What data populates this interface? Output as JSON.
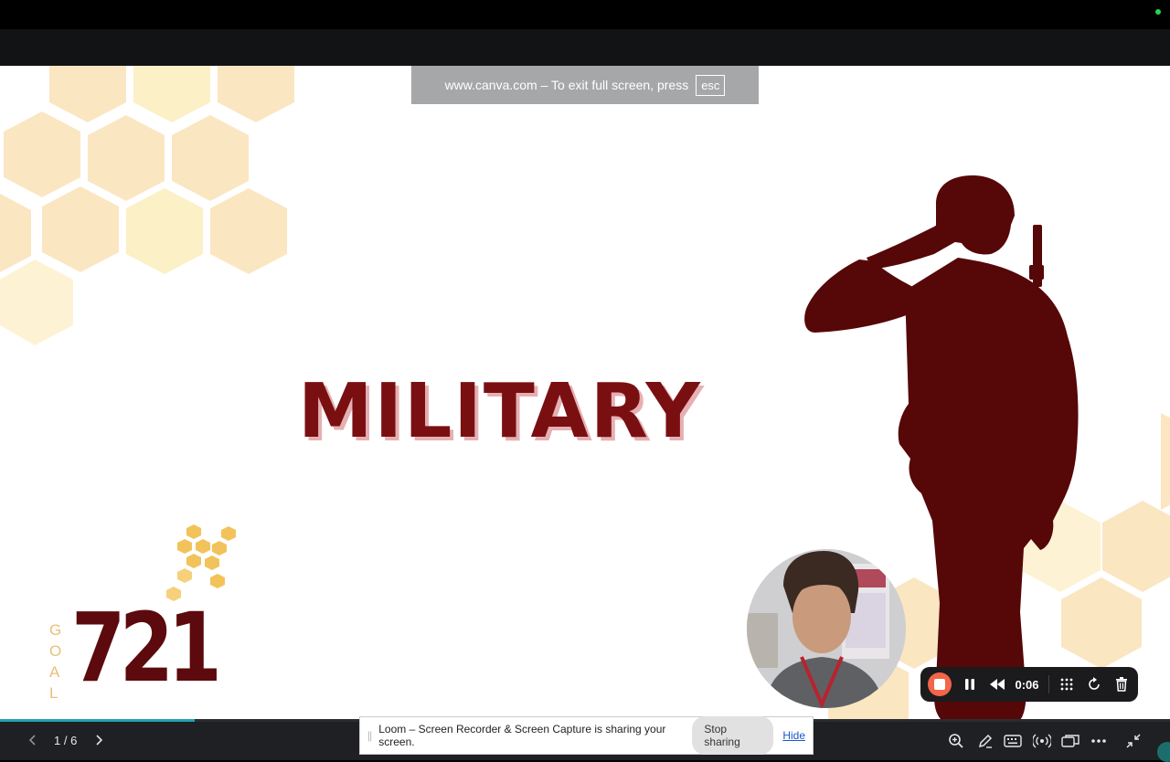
{
  "browser": {
    "fullscreen_notice": "www.canva.com – To exit full screen, press",
    "esc_key": "esc"
  },
  "slide": {
    "title": "MILITARY",
    "logo": {
      "letters": [
        "G",
        "O",
        "A",
        "L"
      ],
      "number": "721"
    }
  },
  "icons": [
    "soldier-silhouette",
    "webcam-avatar",
    "stop-icon",
    "pause-icon",
    "rewind-icon",
    "grid-icon",
    "restart-icon",
    "trash-icon",
    "zoom-in-icon",
    "pen-icon",
    "keyboard-icon",
    "broadcast-icon",
    "present-icon",
    "more-icon",
    "exit-fullscreen-icon"
  ],
  "loom": {
    "timer": "0:06"
  },
  "presenter": {
    "page_indicator": "1 / 6",
    "progress_fraction": 0.1667
  },
  "share_notice": {
    "message": "Loom – Screen Recorder & Screen Capture is sharing your screen.",
    "stop_label": "Stop sharing",
    "hide_label": "Hide"
  },
  "colors": {
    "title_red": "#7a0f12",
    "silhouette": "#560708",
    "hex_light": "#fbe6c2",
    "record_orange": "#f26548",
    "progress_teal": "#23a3b3"
  }
}
